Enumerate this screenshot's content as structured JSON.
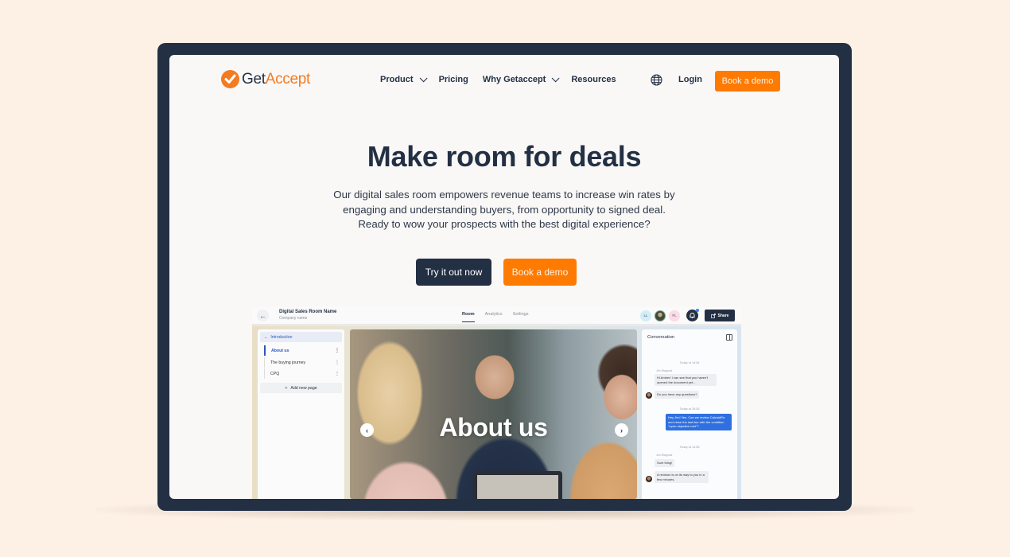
{
  "nav": {
    "brand_get": "Get",
    "brand_accept": "Accept",
    "links": [
      {
        "label": "Product",
        "has_dropdown": true
      },
      {
        "label": "Pricing",
        "has_dropdown": false
      },
      {
        "label": "Why Getaccept",
        "has_dropdown": true
      },
      {
        "label": "Resources",
        "has_dropdown": false
      }
    ],
    "language_icon": "globe-icon",
    "login": "Login",
    "cta": "Book a demo"
  },
  "hero": {
    "title": "Make room for deals",
    "subtitle": "Our digital sales room empowers revenue teams to increase win rates by engaging and understanding buyers, from opportunity to signed deal. Ready to wow your prospects with the best digital experience?",
    "primary_button": "Try it out now",
    "secondary_button": "Book a demo"
  },
  "app_preview": {
    "room_name": "Digital Sales Room Name",
    "company_name": "Company name",
    "tabs": [
      {
        "label": "Room",
        "active": true
      },
      {
        "label": "Analytics",
        "active": false
      },
      {
        "label": "Settings",
        "active": false
      }
    ],
    "avatars": [
      "LL",
      "",
      "FL"
    ],
    "share": "Share",
    "section": "Introduction",
    "pages": [
      {
        "label": "About us",
        "active": true
      },
      {
        "label": "The buying journey",
        "active": false
      },
      {
        "label": "CPQ",
        "active": false
      }
    ],
    "add_page": "Add new page",
    "slide_title": "About us",
    "conversation": {
      "title": "Conversation",
      "messages": [
        {
          "timestamp": "Today at 14:54",
          "sender": "Jim Waypost",
          "bubbles": [
            "Hi Amber! I can see that you haven't opened the document yet...",
            "Do you have any questions?"
          ],
          "direction": "in"
        },
        {
          "timestamp": "Today at 15:05",
          "bubbles": [
            "Hey Jim! Yes. Can we review CalculaFix and close the last line with the condition \"upon objective met\"?"
          ],
          "direction": "out"
        },
        {
          "timestamp": "Today at 14:56",
          "sender": "Jim Waypost",
          "bubbles": [
            "Sure thing!",
            "A revision is on its way to you in a few minutes."
          ],
          "direction": "in"
        }
      ]
    }
  },
  "colors": {
    "brand_orange": "#ff7a00",
    "navy": "#233044",
    "background": "#fdf0e4",
    "accent_blue": "#2f6fe0"
  }
}
